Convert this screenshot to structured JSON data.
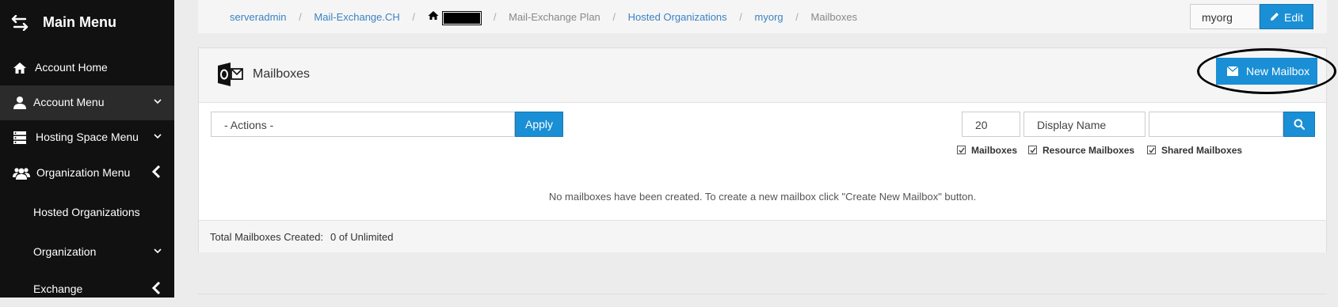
{
  "sidebar": {
    "title": "Main Menu",
    "items": [
      {
        "label": "Account Home"
      },
      {
        "label": "Account Menu"
      },
      {
        "label": "Hosting Space Menu"
      },
      {
        "label": "Organization Menu"
      },
      {
        "label": "Hosted Organizations"
      },
      {
        "label": "Organization"
      },
      {
        "label": "Exchange"
      }
    ]
  },
  "breadcrumb": {
    "items": [
      {
        "label": "serveradmin"
      },
      {
        "label": "Mail-Exchange.CH"
      },
      {
        "label": "Mail-Exchange Plan"
      },
      {
        "label": "Hosted Organizations"
      },
      {
        "label": "myorg"
      },
      {
        "label": "Mailboxes"
      }
    ],
    "separator": "/"
  },
  "org_selector": {
    "value": "myorg"
  },
  "edit_button": {
    "label": "Edit"
  },
  "panel": {
    "title": "Mailboxes",
    "new_button_label": "New Mailbox",
    "actions_select": {
      "value": "- Actions -"
    },
    "apply_label": "Apply",
    "page_size": {
      "value": "20"
    },
    "search_column": {
      "value": "Display Name"
    },
    "search_input": {
      "value": ""
    },
    "filters": [
      {
        "label": "Mailboxes",
        "checked": true
      },
      {
        "label": "Resource Mailboxes",
        "checked": true
      },
      {
        "label": "Shared Mailboxes",
        "checked": true
      }
    ],
    "empty_message": "No mailboxes have been created. To create a new mailbox click \"Create New Mailbox\" button.",
    "footer": {
      "label": "Total Mailboxes Created:",
      "value": "0 of Unlimited"
    }
  },
  "colors": {
    "sidebar_bg": "#111111",
    "accent": "#1a8fd5",
    "link": "#3b82c4"
  }
}
